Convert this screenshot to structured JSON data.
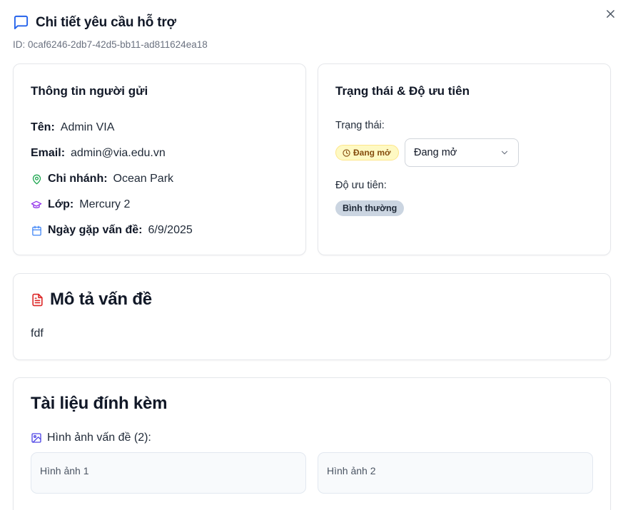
{
  "header": {
    "title": "Chi tiết yêu cầu hỗ trợ",
    "id_text": "ID: 0caf6246-2db7-42d5-bb11-ad811624ea18",
    "icon": "message-square-icon"
  },
  "sender": {
    "title": "Thông tin người gửi",
    "name_label": "Tên:",
    "name_value": "Admin VIA",
    "email_label": "Email:",
    "email_value": "admin@via.edu.vn",
    "branch_label": "Chi nhánh:",
    "branch_value": "Ocean Park",
    "class_label": "Lớp:",
    "class_value": "Mercury 2",
    "date_label": "Ngày gặp vấn đề:",
    "date_value": "6/9/2025"
  },
  "status": {
    "title": "Trạng thái & Độ ưu tiên",
    "status_label": "Trạng thái:",
    "status_badge": "Đang mở",
    "status_select": "Đang mở",
    "priority_label": "Độ ưu tiên:",
    "priority_badge": "Bình thường"
  },
  "description": {
    "title": "Mô tả vấn đề",
    "text": "fdf"
  },
  "attachments": {
    "title": "Tài liệu đính kèm",
    "images_label": "Hình ảnh vấn đề (2):",
    "images": [
      "Hình ảnh 1",
      "Hình ảnh 2"
    ]
  },
  "colors": {
    "accent_blue": "#2563eb",
    "pin_green": "#16a34a",
    "cap_purple": "#9333ea",
    "calendar_blue": "#3b82f6",
    "doc_red": "#dc2626",
    "badge_yellow": "#fef9c3",
    "badge_gray": "#cbd5e1"
  }
}
